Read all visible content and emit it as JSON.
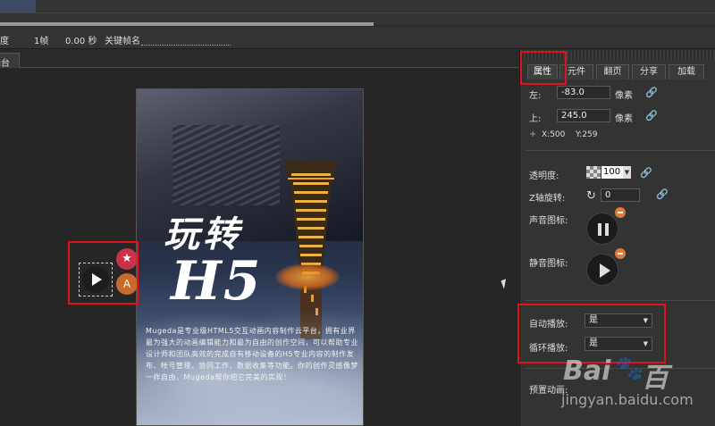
{
  "timeline": {
    "speed_label": "速度",
    "frame": "1帧",
    "seconds": "0.00 秒",
    "keyframe_name_label": "关键帧名"
  },
  "stage_tab": {
    "label": "舞台"
  },
  "canvas": {
    "title_line1": "玩转",
    "title_line2": "H5",
    "description": "Mugeda是专业级HTML5交互动画内容制作云平台，拥有业界最为强大的动画编辑能力和最为自由的创作空间，可以帮助专业设计师和团队高效的完成自有移动设备的H5专业内容的制作发布、帐号管理、协同工作、数据收集等功能。你的创作灵感像梦一样自由，Mugeda帮你把它完美的实现！"
  },
  "widget": {
    "fav_icon": "★",
    "text_icon": "A"
  },
  "panel": {
    "tabs": [
      "属性",
      "元件",
      "翻页",
      "分享",
      "加载"
    ],
    "left_label": "左:",
    "left_value": "-83.0",
    "top_label": "上:",
    "top_value": "245.0",
    "unit": "像素",
    "cross_icon": "+",
    "x_readout": "X:500",
    "y_readout": "Y:259",
    "opacity_label": "透明度:",
    "opacity_value": "100",
    "z_rotate_label": "Z轴旋转:",
    "z_rotate_value": "0",
    "sound_icon_label": "声音图标:",
    "mute_icon_label": "静音图标:",
    "autoplay_label": "自动播放:",
    "autoplay_value": "是",
    "loop_label": "循环播放:",
    "loop_value": "是",
    "preset_label": "预置动画:"
  },
  "watermark": {
    "logo": "Bai",
    "logo2": "百",
    "sub": "jingyan.baidu.com"
  },
  "colors": {
    "highlight": "#e0121b",
    "panel_bg": "#333333",
    "stage_bg": "#262626"
  }
}
